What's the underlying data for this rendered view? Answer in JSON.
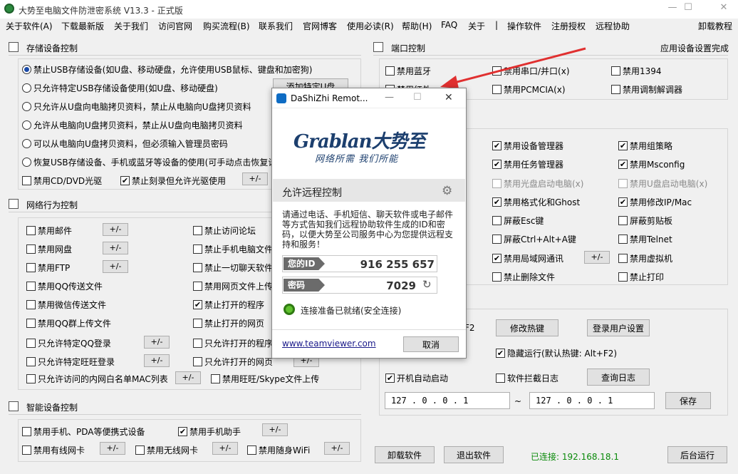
{
  "window": {
    "title": "大势至电脑文件防泄密系统 V13.3 - 正式版"
  },
  "menu": [
    "关于软件(A)",
    "下载最新版",
    "关于我们",
    "访问官网",
    "购买流程(B)",
    "联系我们",
    "官网博客",
    "使用必读(R)",
    "帮助(H)",
    "FAQ",
    "关于",
    "|",
    "操作软件",
    "注册授权",
    "远程协助",
    "卸载教程"
  ],
  "storage": {
    "title": "存储设备控制",
    "radios": [
      {
        "label": "禁止USB存储设备(如U盘、移动硬盘，允许使用USB鼠标、键盘和加密狗)",
        "selected": true
      },
      {
        "label": "只允许特定USB存储设备使用(如U盘、移动硬盘)",
        "selected": false
      },
      {
        "label": "只允许从U盘向电脑拷贝资料，禁止从电脑向U盘拷贝资料",
        "selected": false
      },
      {
        "label": "允许从电脑向U盘拷贝资料，禁止从U盘向电脑拷贝资料",
        "selected": false
      },
      {
        "label": "可以从电脑向U盘拷贝资料，但必须输入管理员密码",
        "selected": false
      },
      {
        "label": "恢复USB存储设备、手机或蓝牙等设备的使用(可手动点击恢复设",
        "selected": false
      }
    ],
    "add_button": "添加特定U盘",
    "cd_label": "禁用CD/DVD光驱",
    "burn_label": "禁止刻录但允许光驱使用",
    "pm": "+/-"
  },
  "port": {
    "title": "端口控制",
    "status": "应用设备设置完成",
    "items": [
      {
        "label": "禁用蓝牙",
        "checked": false
      },
      {
        "label": "禁用串口/并口(x)",
        "checked": false
      },
      {
        "label": "禁用1394",
        "checked": false
      },
      {
        "label": "禁用红外",
        "checked": false
      },
      {
        "label": "禁用PCMCIA(x)",
        "checked": false
      },
      {
        "label": "禁用调制解调器",
        "checked": false
      }
    ]
  },
  "system": {
    "items": [
      {
        "label": "禁用设备管理器",
        "checked": true,
        "disabled": false
      },
      {
        "label": "禁用组策略",
        "checked": true,
        "disabled": false
      },
      {
        "label": "禁用任务管理器",
        "checked": true,
        "disabled": false
      },
      {
        "label": "禁用Msconfig",
        "checked": true,
        "disabled": false
      },
      {
        "label": "禁用光盘启动电脑(x)",
        "checked": false,
        "disabled": true
      },
      {
        "label": "禁用U盘启动电脑(x)",
        "checked": false,
        "disabled": true
      },
      {
        "label": "禁用格式化和Ghost",
        "checked": true,
        "disabled": false
      },
      {
        "label": "禁用修改IP/Mac",
        "checked": true,
        "disabled": false
      },
      {
        "label": "屏蔽Esc键",
        "checked": false,
        "disabled": false
      },
      {
        "label": "屏蔽剪贴板",
        "checked": false,
        "disabled": false
      },
      {
        "label": "屏蔽Ctrl+Alt+A键",
        "checked": false,
        "disabled": false
      },
      {
        "label": "禁用Telnet",
        "checked": false,
        "disabled": false
      },
      {
        "label": "禁用局域网通讯",
        "checked": true,
        "disabled": false
      },
      {
        "label": "禁用虚拟机",
        "checked": false,
        "disabled": false
      },
      {
        "label": "禁止删除文件",
        "checked": false,
        "disabled": false
      },
      {
        "label": "禁止打印",
        "checked": false,
        "disabled": false
      }
    ]
  },
  "network": {
    "title": "网络行为控制",
    "left": [
      {
        "label": "禁用邮件",
        "checked": false
      },
      {
        "label": "禁用网盘",
        "checked": false
      },
      {
        "label": "禁用FTP",
        "checked": false
      },
      {
        "label": "禁用QQ传送文件",
        "checked": false
      },
      {
        "label": "禁用微信传送文件",
        "checked": false
      },
      {
        "label": "禁用QQ群上传文件",
        "checked": false
      },
      {
        "label": "只允许特定QQ登录",
        "checked": false
      },
      {
        "label": "只允许特定旺旺登录",
        "checked": false
      },
      {
        "label": "只允许访问的内网白名单MAC列表",
        "checked": false
      }
    ],
    "right": [
      {
        "label": "禁止访问论坛",
        "checked": false
      },
      {
        "label": "禁止手机电脑文件",
        "checked": false
      },
      {
        "label": "禁止一切聊天软件",
        "checked": false
      },
      {
        "label": "禁用网页文件上传",
        "checked": false
      },
      {
        "label": "禁止打开的程序",
        "checked": true
      },
      {
        "label": "禁止打开的网页",
        "checked": false
      },
      {
        "label": "只允许打开的程序",
        "checked": false
      },
      {
        "label": "只允许打开的网页",
        "checked": false
      },
      {
        "label": "禁用旺旺/Skype文件上传",
        "checked": false
      }
    ]
  },
  "smart": {
    "title": "智能设备控制",
    "items": [
      {
        "label": "禁用手机、PDA等便携式设备",
        "checked": false
      },
      {
        "label": "禁用手机助手",
        "checked": true
      },
      {
        "label": "禁用有线网卡",
        "checked": false
      },
      {
        "label": "禁用无线网卡",
        "checked": false
      },
      {
        "label": "禁用随身WiFi",
        "checked": false
      }
    ]
  },
  "settings": {
    "hotkey_suffix": "F2",
    "modify_hotkey": "修改热键",
    "login_settings": "登录用户设置",
    "hide_run": "隐藏运行(默认热键: Alt+F2)",
    "autostart": "开机自动启动",
    "intercept_log": "软件拦截日志",
    "query_log": "查询日志",
    "ip_from": "127 . 0 . 0 . 1",
    "ip_tilde": "~",
    "ip_to": "127 . 0 . 0 . 1",
    "save": "保存"
  },
  "bottom": {
    "uninstall": "卸载软件",
    "exit": "退出软件",
    "connected": "已连接: 192.168.18.1",
    "background": "后台运行"
  },
  "dialog": {
    "title": "DaShiZhi Remot...",
    "logo": "Grablan大势至",
    "slogan": "网络所需  我们所能",
    "header": "允许远程控制",
    "desc": "请通过电话、手机短信、聊天软件或电子邮件等方式告知我们远程协助软件生成的ID和密码，以便大势至公司服务中心为您提供远程支持和服务！",
    "id_label": "您的ID",
    "id_value": "916 255 657",
    "pw_label": "密码",
    "pw_value": "7029",
    "status": "连接准备已就绪(安全连接)",
    "link": "www.teamviewer.com",
    "cancel": "取消"
  },
  "colors": {
    "accent_arrow": "#e03030",
    "connected_green": "#0a8a0a",
    "radio_dot": "#1a4aa8"
  }
}
